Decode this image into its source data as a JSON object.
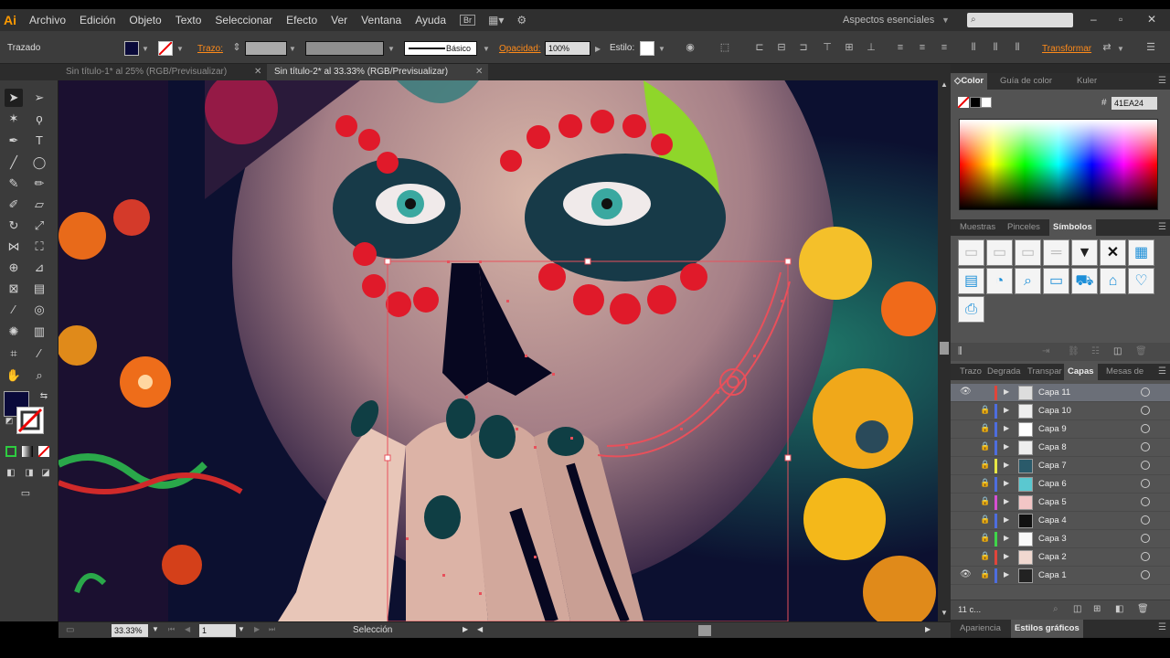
{
  "app": {
    "logo": "Ai"
  },
  "menu": {
    "items": [
      "Archivo",
      "Edición",
      "Objeto",
      "Texto",
      "Seleccionar",
      "Efecto",
      "Ver",
      "Ventana",
      "Ayuda"
    ],
    "bridge": "Br",
    "workspace": "Aspectos esenciales"
  },
  "control": {
    "object_label": "Trazado",
    "stroke_label": "Trazo:",
    "stroke_profile": "Básico",
    "opacity_label": "Opacidad:",
    "opacity_value": "100%",
    "style_label": "Estilo:",
    "transform_label": "Transformar"
  },
  "tabs": [
    {
      "label": "Sin título-1* al 25% (RGB/Previsualizar)",
      "active": false
    },
    {
      "label": "Sin título-2* al 33.33% (RGB/Previsualizar)",
      "active": true
    }
  ],
  "status": {
    "zoom": "33.33%",
    "artboard": "1",
    "tool": "Selección"
  },
  "color_panel": {
    "tabs": [
      "Color",
      "Guía de color",
      "Kuler"
    ],
    "hex": "41EA24"
  },
  "symbols_panel": {
    "tabs": [
      "Muestras",
      "Pinceles",
      "Símbolos"
    ]
  },
  "layers_panel": {
    "tabs": [
      "Trazo",
      "Degrada",
      "Transpar",
      "Capas",
      "Mesas de"
    ],
    "footer_count": "11 c...",
    "layers": [
      {
        "name": "Capa 11",
        "color": "#e0453b",
        "visible": true,
        "locked": false,
        "selected": true
      },
      {
        "name": "Capa 10",
        "color": "#4d6dde",
        "visible": false,
        "locked": true,
        "selected": false
      },
      {
        "name": "Capa 9",
        "color": "#4d6dde",
        "visible": false,
        "locked": true,
        "selected": false
      },
      {
        "name": "Capa 8",
        "color": "#4d6dde",
        "visible": false,
        "locked": true,
        "selected": false
      },
      {
        "name": "Capa 7",
        "color": "#e6e645",
        "visible": false,
        "locked": true,
        "selected": false
      },
      {
        "name": "Capa 6",
        "color": "#4d6dde",
        "visible": false,
        "locked": true,
        "selected": false
      },
      {
        "name": "Capa 5",
        "color": "#d64fd2",
        "visible": false,
        "locked": true,
        "selected": false
      },
      {
        "name": "Capa 4",
        "color": "#4d6dde",
        "visible": false,
        "locked": true,
        "selected": false
      },
      {
        "name": "Capa 3",
        "color": "#3fd54a",
        "visible": false,
        "locked": true,
        "selected": false
      },
      {
        "name": "Capa 2",
        "color": "#e0453b",
        "visible": false,
        "locked": true,
        "selected": false
      },
      {
        "name": "Capa 1",
        "color": "#4d6dde",
        "visible": true,
        "locked": true,
        "selected": false
      }
    ]
  },
  "bottom_panel": {
    "tabs": [
      "Apariencia",
      "Estilos gráficos"
    ]
  },
  "colors": {
    "fill_swatch": "#0a0a3a",
    "selection": "#e8505b"
  }
}
